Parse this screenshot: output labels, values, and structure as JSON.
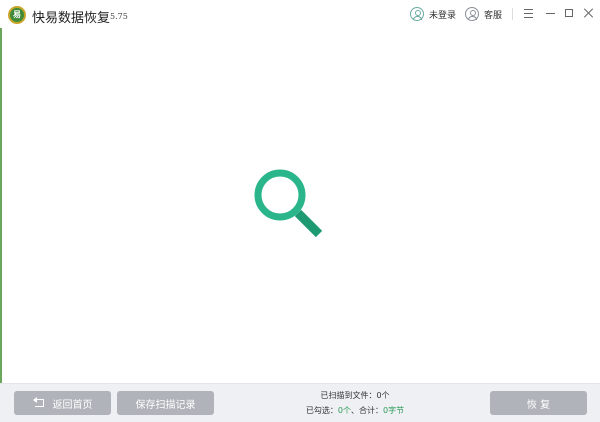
{
  "window": {
    "logo_text": "易",
    "title": "快易数据恢复",
    "version": "5.75"
  },
  "titlebar": {
    "login_label": "未登录",
    "support_label": "客服"
  },
  "status": {
    "line1_label": "已扫描到文件：",
    "line1_value": "0个",
    "selected_label": "已勾选：",
    "selected_value": "0个",
    "total_label": "、合计：",
    "total_value": "0字节"
  },
  "footer": {
    "back_label": "返回首页",
    "save_label": "保存扫描记录",
    "restore_label": "恢 复"
  },
  "colors": {
    "accent": "#2bb58a",
    "accent_dark": "#1e9a73",
    "button_disabled": "#b0b3ba",
    "footer_bg": "#eef0f4",
    "stat_green": "#2e9a57"
  }
}
